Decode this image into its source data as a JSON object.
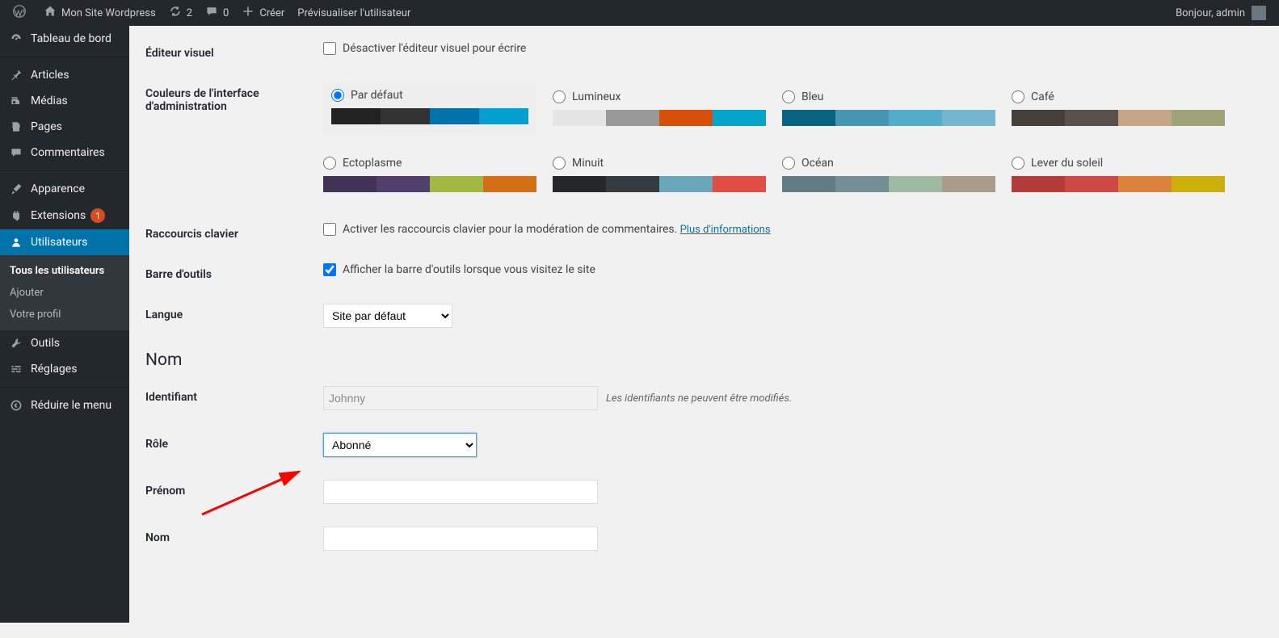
{
  "adminbar": {
    "site_name": "Mon Site Wordpress",
    "updates": "2",
    "comments": "0",
    "new": "Créer",
    "preview": "Prévisualiser l'utilisateur",
    "greeting": "Bonjour, admin"
  },
  "menu": {
    "dashboard": "Tableau de bord",
    "posts": "Articles",
    "media": "Médias",
    "pages": "Pages",
    "comments": "Commentaires",
    "appearance": "Apparence",
    "plugins": "Extensions",
    "plugins_badge": "1",
    "users": "Utilisateurs",
    "users_sub": {
      "all": "Tous les utilisateurs",
      "add": "Ajouter",
      "profile": "Votre profil"
    },
    "tools": "Outils",
    "settings": "Réglages",
    "collapse": "Réduire le menu"
  },
  "form": {
    "visual_editor_label": "Éditeur visuel",
    "visual_editor_cb": "Désactiver l'éditeur visuel pour écrire",
    "admin_color_label": "Couleurs de l'interface d'administration",
    "shortcuts_label": "Raccourcis clavier",
    "shortcuts_cb": "Activer les raccourcis clavier pour la modération de commentaires.",
    "shortcuts_link": "Plus d'informations",
    "toolbar_label": "Barre d'outils",
    "toolbar_cb": "Afficher la barre d'outils lorsque vous visitez le site",
    "language_label": "Langue",
    "language_value": "Site par défaut",
    "section_name": "Nom",
    "username_label": "Identifiant",
    "username_value": "Johnny",
    "username_hint": "Les identifiants ne peuvent être modifiés.",
    "role_label": "Rôle",
    "role_value": "Abonné",
    "firstname_label": "Prénom",
    "lastname_label": "Nom"
  },
  "color_schemes": [
    {
      "name": "Par défaut",
      "selected": true,
      "colors": [
        "#222",
        "#333",
        "#0073aa",
        "#00a0d2"
      ]
    },
    {
      "name": "Lumineux",
      "colors": [
        "#e5e5e5",
        "#999",
        "#d64e07",
        "#04a4cc"
      ]
    },
    {
      "name": "Bleu",
      "colors": [
        "#096484",
        "#4796b3",
        "#52accc",
        "#74B6CE"
      ]
    },
    {
      "name": "Café",
      "colors": [
        "#46403c",
        "#59524c",
        "#c7a589",
        "#9ea476"
      ]
    },
    {
      "name": "Ectoplasme",
      "colors": [
        "#413256",
        "#523f6d",
        "#a3b745",
        "#d46f15"
      ]
    },
    {
      "name": "Minuit",
      "colors": [
        "#25282b",
        "#363b3f",
        "#69a8bb",
        "#e14d43"
      ]
    },
    {
      "name": "Océan",
      "colors": [
        "#627c83",
        "#738e96",
        "#9ebaa0",
        "#aa9d88"
      ]
    },
    {
      "name": "Lever du soleil",
      "colors": [
        "#b43c38",
        "#cf4944",
        "#dd823b",
        "#ccaf0b"
      ]
    }
  ]
}
